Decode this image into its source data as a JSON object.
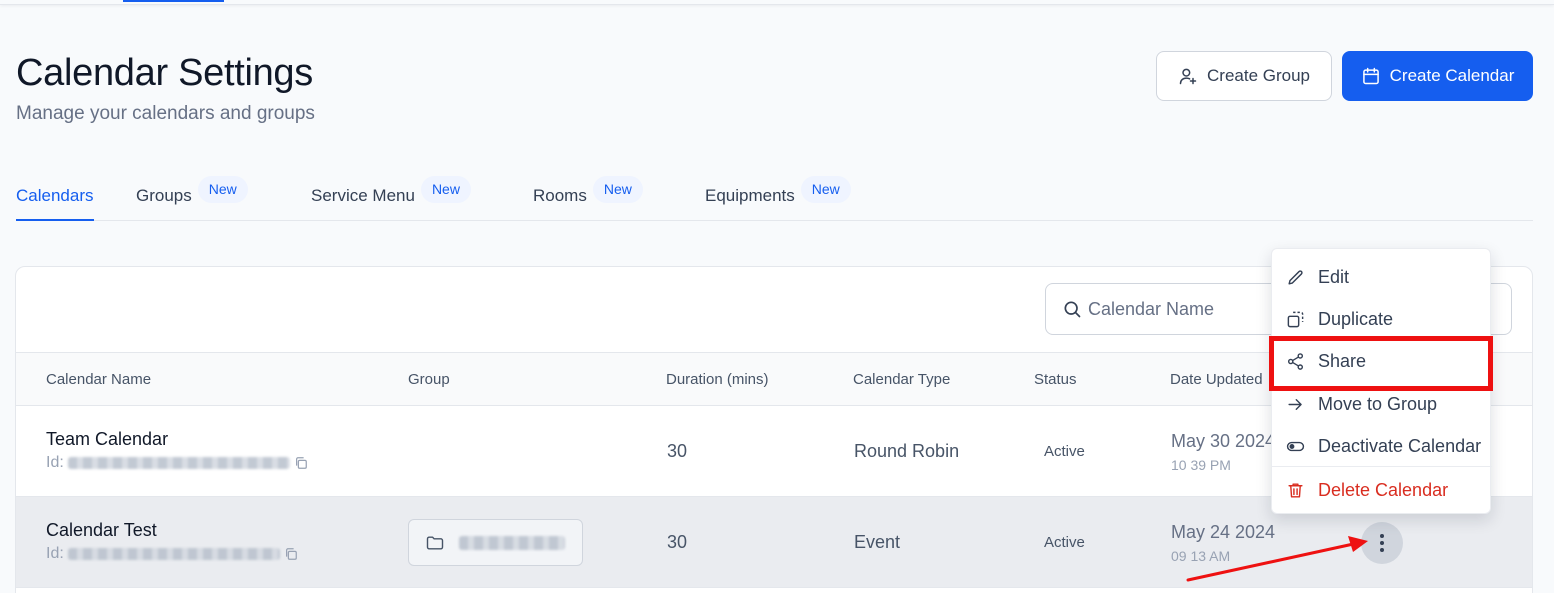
{
  "header": {
    "title": "Calendar Settings",
    "subtitle": "Manage your calendars and groups",
    "create_group_label": "Create Group",
    "create_calendar_label": "Create Calendar"
  },
  "tabs": [
    {
      "label": "Calendars",
      "badge": ""
    },
    {
      "label": "Groups",
      "badge": "New"
    },
    {
      "label": "Service Menu",
      "badge": "New"
    },
    {
      "label": "Rooms",
      "badge": "New"
    },
    {
      "label": "Equipments",
      "badge": "New"
    }
  ],
  "search": {
    "placeholder": "Calendar Name"
  },
  "table": {
    "columns": [
      "Calendar Name",
      "Group",
      "Duration (mins)",
      "Calendar Type",
      "Status",
      "Date Updated"
    ],
    "rows": [
      {
        "name": "Team Calendar",
        "id_prefix": "Id:",
        "duration": "30",
        "type": "Round Robin",
        "status": "Active",
        "date": "May 30 2024",
        "time": "10 39 PM"
      },
      {
        "name": "Calendar Test",
        "id_prefix": "Id:",
        "duration": "30",
        "type": "Event",
        "status": "Active",
        "date": "May 24 2024",
        "time": "09 13 AM"
      }
    ]
  },
  "context_menu": {
    "items": [
      {
        "label": "Edit",
        "icon": "pencil-icon"
      },
      {
        "label": "Duplicate",
        "icon": "duplicate-icon"
      },
      {
        "label": "Share",
        "icon": "share-icon"
      },
      {
        "label": "Move to Group",
        "icon": "arrow-right-icon"
      },
      {
        "label": "Deactivate Calendar",
        "icon": "toggle-icon"
      },
      {
        "label": "Delete Calendar",
        "icon": "trash-icon"
      }
    ]
  },
  "colors": {
    "primary": "#155eef",
    "danger": "#d92d20",
    "annotation": "#ee1111"
  }
}
